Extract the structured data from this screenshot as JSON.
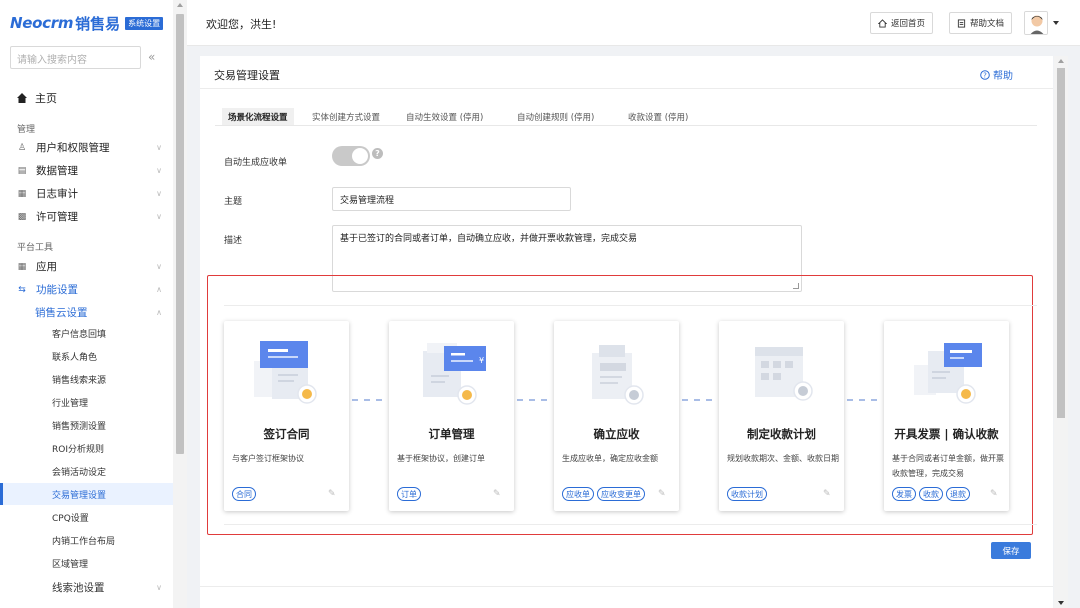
{
  "logo": {
    "brand": "Neocrm",
    "product": "销售易",
    "badge": "系统设置"
  },
  "sidebar": {
    "search_placeholder": "请输入搜索内容",
    "collapse": "«",
    "home": "主页",
    "section_manage": "管理",
    "manage_items": [
      {
        "label": "用户和权限管理",
        "icon": "users-icon"
      },
      {
        "label": "数据管理",
        "icon": "database-icon"
      },
      {
        "label": "日志审计",
        "icon": "log-icon"
      },
      {
        "label": "许可管理",
        "icon": "lock-icon"
      }
    ],
    "section_platform": "平台工具",
    "app": "应用",
    "feature_settings": "功能设置",
    "sales_cloud": "销售云设置",
    "leaves": [
      "客户信息回填",
      "联系人角色",
      "销售线索来源",
      "行业管理",
      "销售预测设置",
      "ROI分析规则",
      "会销活动设定",
      "交易管理设置",
      "CPQ设置",
      "内销工作台布局",
      "区域管理",
      "线索池设置"
    ],
    "active_leaf": "交易管理设置"
  },
  "topbar": {
    "welcome": "欢迎您，洪生!",
    "home_btn": "返回首页",
    "help_btn": "帮助文档"
  },
  "panel": {
    "title": "交易管理设置",
    "help": "帮助",
    "tabs": [
      "场景化流程设置",
      "实体创建方式设置",
      "自动生效设置 (停用)",
      "自动创建规则 (停用)",
      "收款设置 (停用)"
    ],
    "active_tab": "场景化流程设置",
    "auto_generate_label": "自动生成应收单",
    "auto_generate_enabled": false,
    "subject_label": "主题",
    "subject_value": "交易管理流程",
    "desc_label": "描述",
    "desc_value": "基于已签订的合同或者订单，自动确立应收，并做开票收款管理，完成交易",
    "save": "保存"
  },
  "flow_cards": [
    {
      "title": "签订合同",
      "desc": "与客户签订框架协议",
      "tags": [
        "合同"
      ]
    },
    {
      "title": "订单管理",
      "desc": "基于框架协议，创建订单",
      "tags": [
        "订单"
      ]
    },
    {
      "title": "确立应收",
      "desc": "生成应收单，确定应收金额",
      "tags": [
        "应收单",
        "应收变更单"
      ]
    },
    {
      "title": "制定收款计划",
      "desc": "规划收款期次、金额、收款日期",
      "tags": [
        "收款计划"
      ]
    },
    {
      "title": "开具发票 | 确认收款",
      "desc": "基于合同或者订单金额，做开票收款管理，完成交易",
      "tags": [
        "发票",
        "收款",
        "退款"
      ]
    }
  ],
  "colors": {
    "accent": "#2b6cd6",
    "highlight_frame": "#e03b3b"
  }
}
